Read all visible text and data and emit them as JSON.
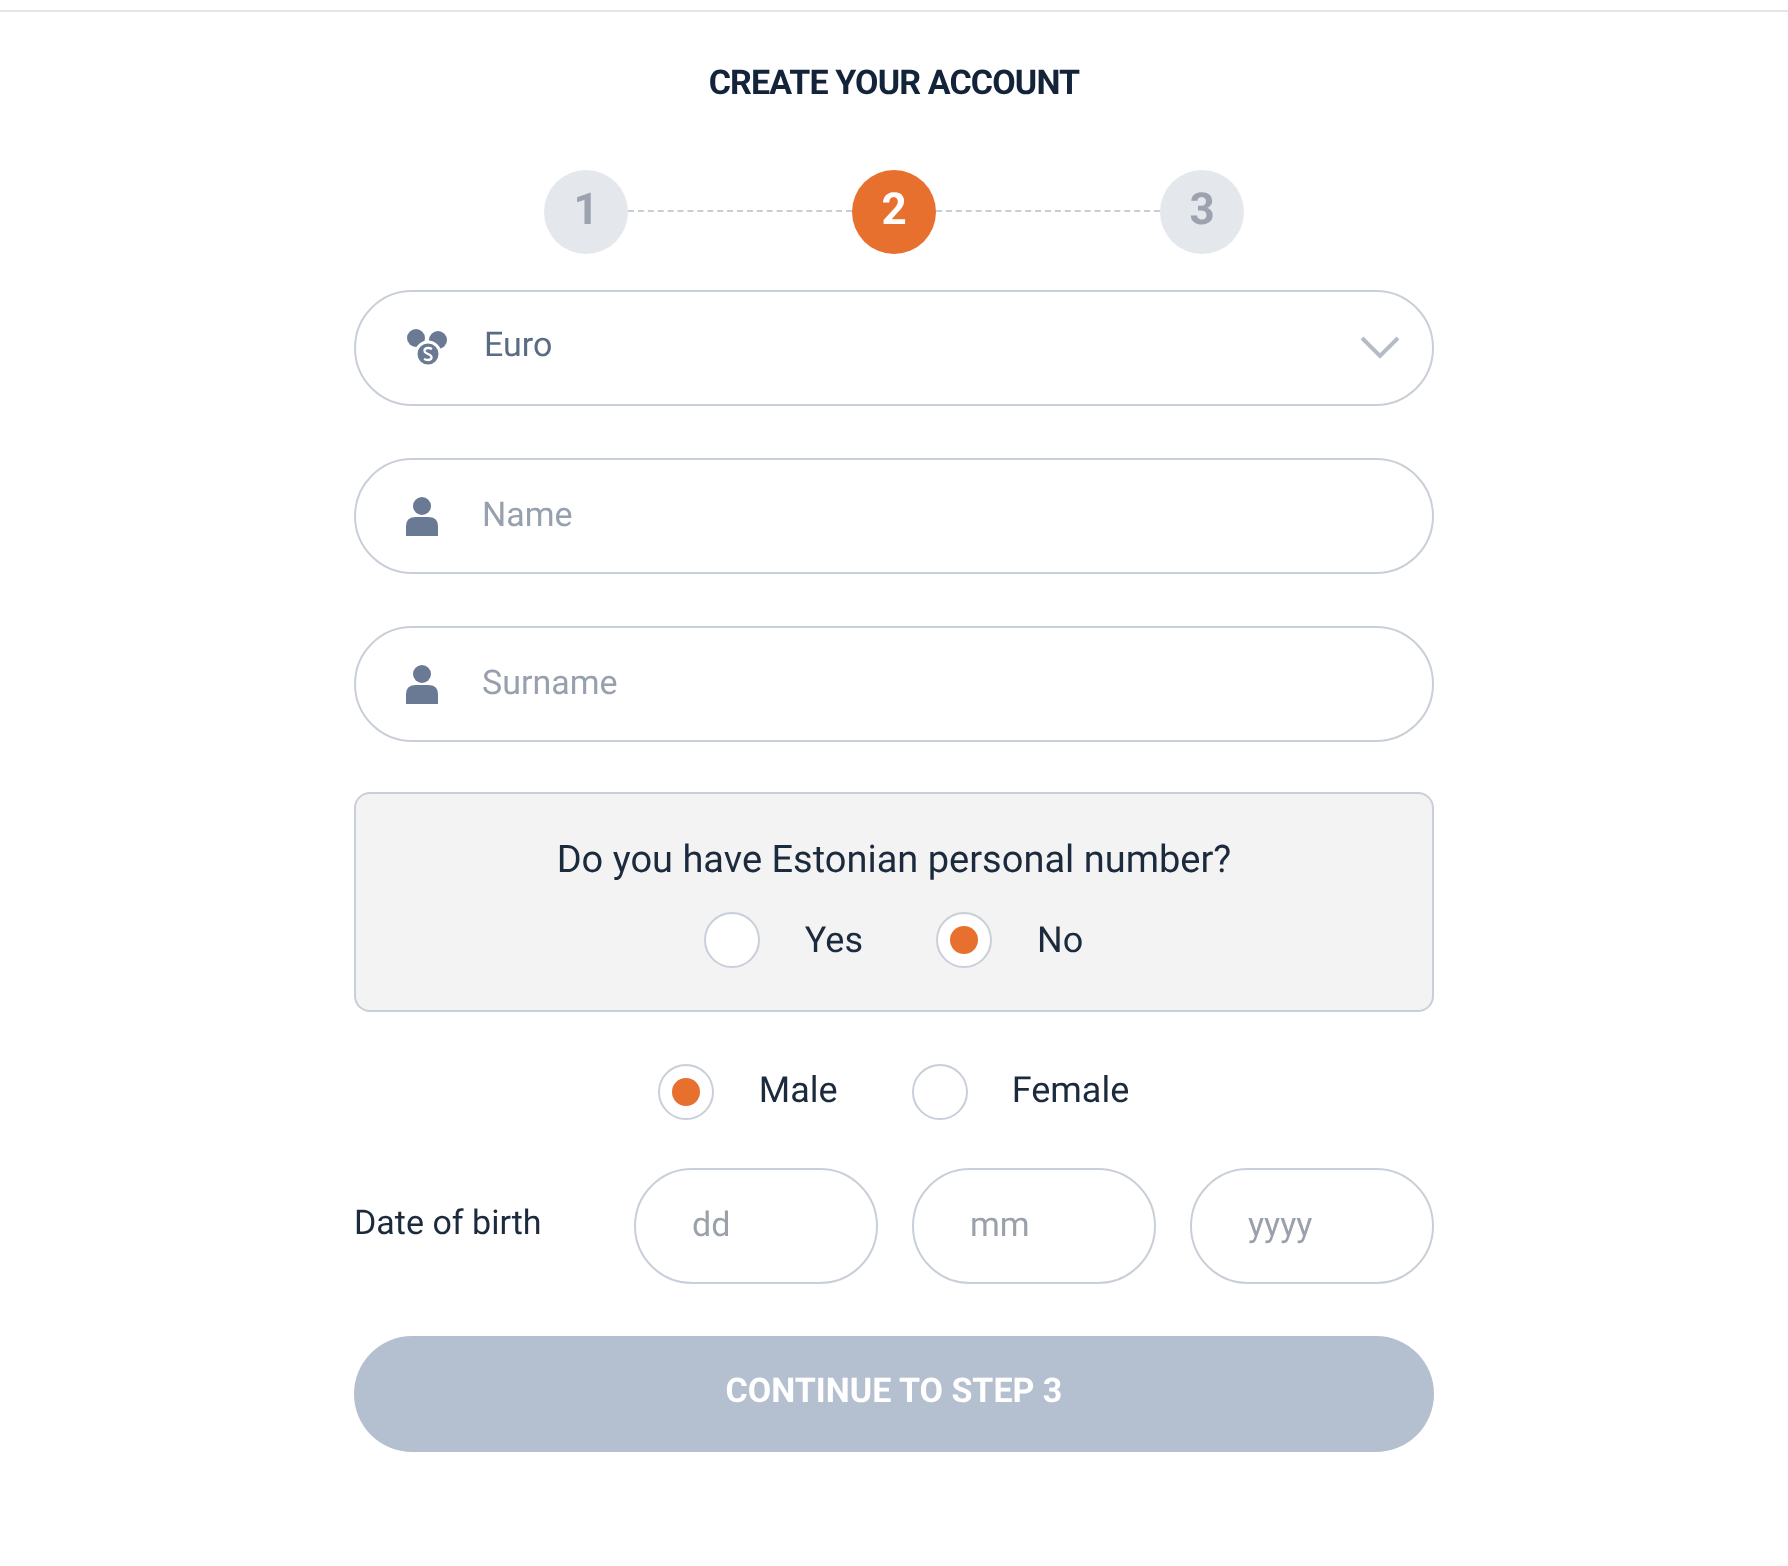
{
  "title": "CREATE YOUR ACCOUNT",
  "steps": [
    {
      "label": "1",
      "selected": false
    },
    {
      "label": "2",
      "selected": true
    },
    {
      "label": "3",
      "selected": false
    }
  ],
  "currency": {
    "value": "Euro"
  },
  "fields": [
    {
      "placeholder": "Name"
    },
    {
      "placeholder": "Surname"
    }
  ],
  "personal_number": {
    "question": "Do you have Estonian personal number?",
    "options": [
      {
        "label": "Yes",
        "selected": false
      },
      {
        "label": "No",
        "selected": true
      }
    ]
  },
  "gender": [
    {
      "label": "Male",
      "selected": true
    },
    {
      "label": "Female",
      "selected": false
    }
  ],
  "date_of_birth": {
    "label": "Date of birth",
    "fields": [
      {
        "placeholder": "dd"
      },
      {
        "placeholder": "mm"
      },
      {
        "placeholder": "yyyy"
      }
    ]
  },
  "continue_button": {
    "label": "CONTINUE TO STEP 3",
    "disabled": true
  }
}
